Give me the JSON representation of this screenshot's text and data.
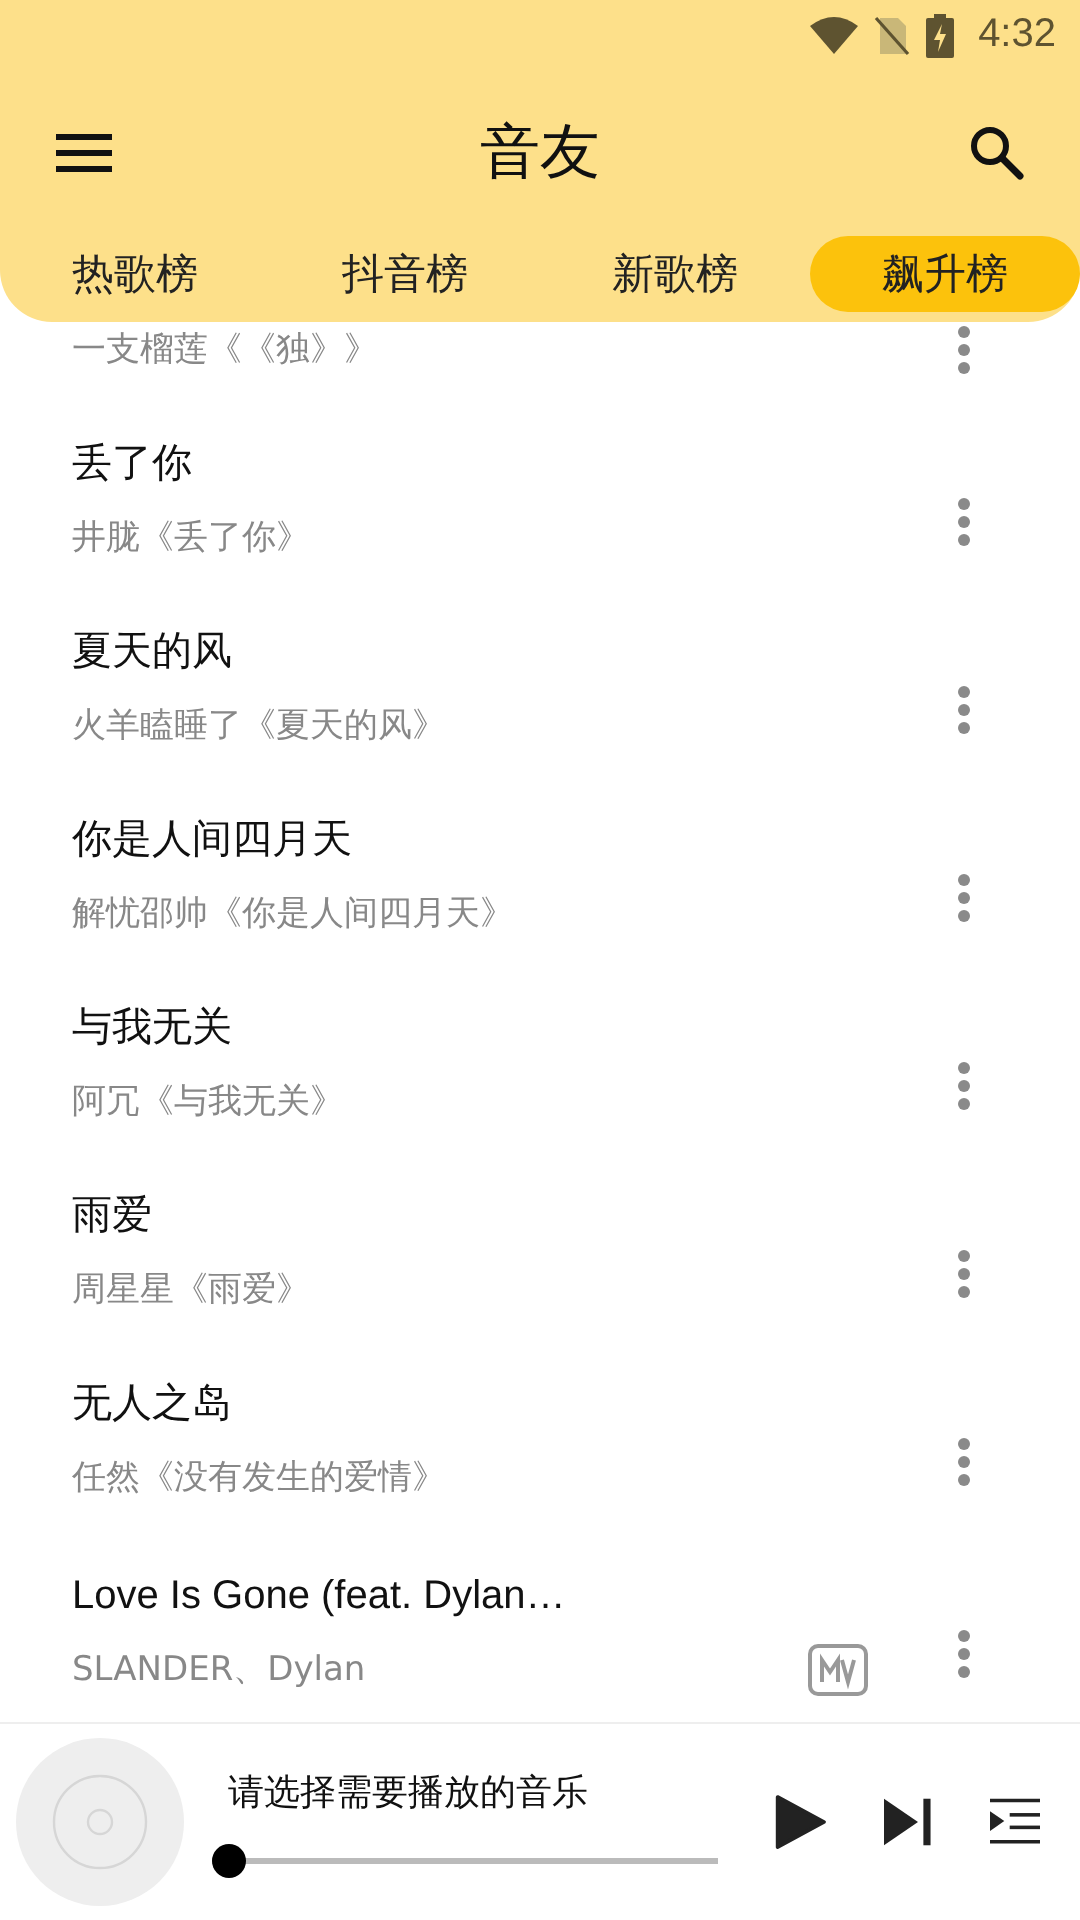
{
  "status_bar": {
    "time": "4:32"
  },
  "app_bar": {
    "title": "音友"
  },
  "tabs": [
    {
      "label": "热歌榜",
      "selected": false
    },
    {
      "label": "抖音榜",
      "selected": false
    },
    {
      "label": "新歌榜",
      "selected": false
    },
    {
      "label": "飙升榜",
      "selected": true
    }
  ],
  "songs": [
    {
      "subtitle": "一支榴莲《《独》》"
    },
    {
      "title": "丢了你",
      "subtitle": "井胧《丢了你》"
    },
    {
      "title": "夏天的风",
      "subtitle": "火羊瞌睡了《夏天的风》"
    },
    {
      "title": "你是人间四月天",
      "subtitle": "解忧邵帅《你是人间四月天》"
    },
    {
      "title": "与我无关",
      "subtitle": "阿冗《与我无关》"
    },
    {
      "title": "雨爱",
      "subtitle": "周星星《雨爱》"
    },
    {
      "title": "无人之岛",
      "subtitle": "任然《没有发生的爱情》"
    },
    {
      "title": "Love Is Gone (feat. Dylan…",
      "subtitle": "SLANDER、Dylan",
      "mv": true
    }
  ],
  "player": {
    "prompt": "请选择需要播放的音乐",
    "level": 0
  }
}
